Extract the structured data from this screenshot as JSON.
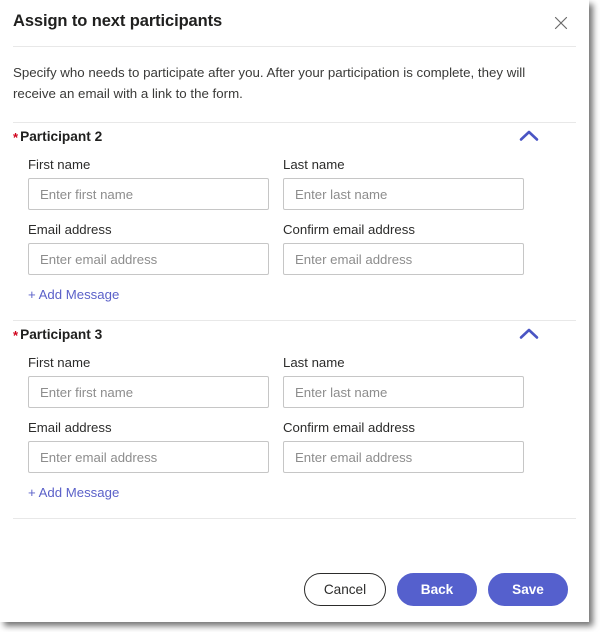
{
  "dialog": {
    "title": "Assign to next participants",
    "close_icon": "close-icon",
    "description": "Specify who needs to participate after you. After your participation is complete, they will receive an email with a link to the form."
  },
  "sections": [
    {
      "required_marker": "*",
      "title": "Participant 2",
      "collapse_icon": "chevron-up-icon",
      "fields": [
        {
          "label": "First name",
          "value": "",
          "placeholder": "Enter first name",
          "name": "first-name-input"
        },
        {
          "label": "Last name",
          "value": "",
          "placeholder": "Enter last name",
          "name": "last-name-input"
        },
        {
          "label": "Email address",
          "value": "",
          "placeholder": "Enter email address",
          "name": "email-address-input"
        },
        {
          "label": "Confirm email address",
          "value": "",
          "placeholder": "Enter email address",
          "name": "confirm-email-address-input"
        }
      ],
      "add_message_label": "+ Add Message"
    },
    {
      "required_marker": "*",
      "title": "Participant 3",
      "collapse_icon": "chevron-up-icon",
      "fields": [
        {
          "label": "First name",
          "value": "",
          "placeholder": "Enter first name",
          "name": "first-name-input"
        },
        {
          "label": "Last name",
          "value": "",
          "placeholder": "Enter last name",
          "name": "last-name-input"
        },
        {
          "label": "Email address",
          "value": "",
          "placeholder": "Enter email address",
          "name": "email-address-input"
        },
        {
          "label": "Confirm email address",
          "value": "",
          "placeholder": "Enter email address",
          "name": "confirm-email-address-input"
        }
      ],
      "add_message_label": "+ Add Message"
    }
  ],
  "footer": {
    "cancel_label": "Cancel",
    "back_label": "Back",
    "save_label": "Save"
  },
  "colors": {
    "accent": "#5560cd",
    "link": "#5b61c9",
    "required": "#d0021b",
    "text": "#20201f",
    "border": "#c6c6c6",
    "divider": "#e8e8e8"
  }
}
